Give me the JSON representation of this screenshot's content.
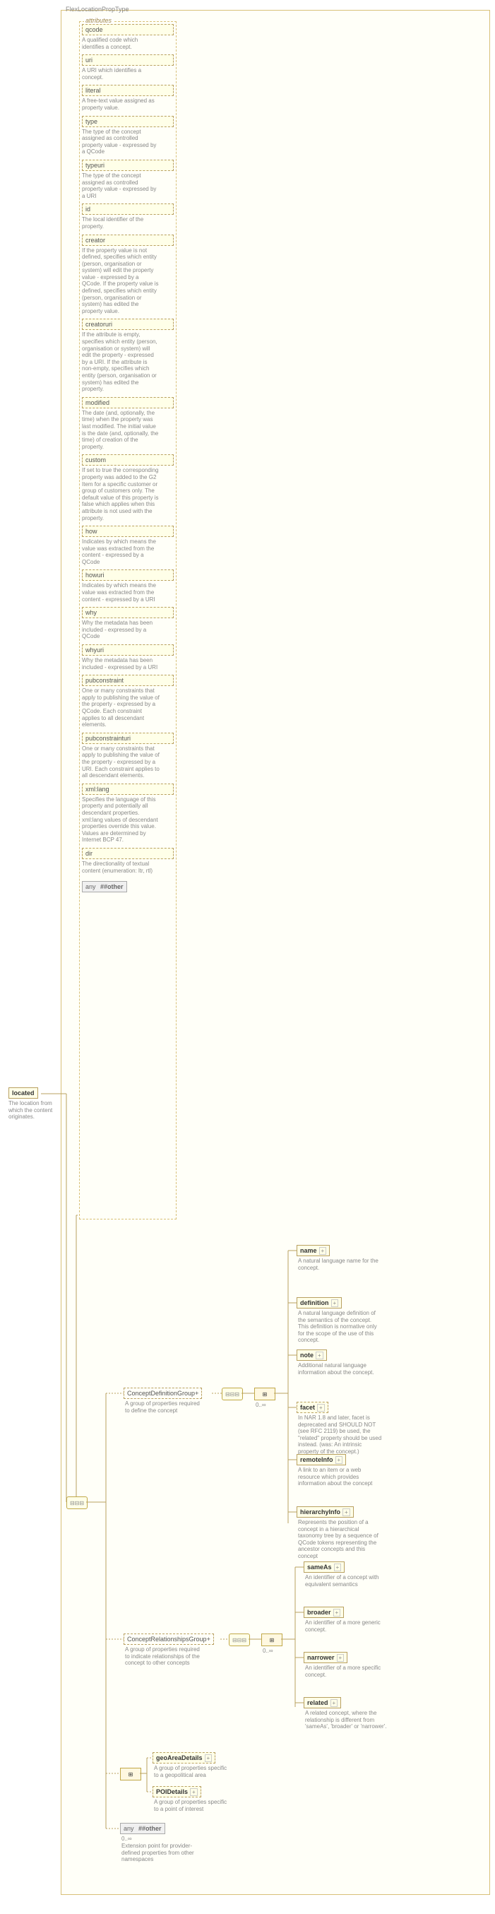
{
  "root": {
    "type_name": "FlexLocationPropType",
    "located": {
      "name": "located",
      "desc": "The location from which the content originates."
    },
    "attributes_label": "attributes",
    "attrs": [
      {
        "name": "qcode",
        "desc": "A qualified code which identifies a concept."
      },
      {
        "name": "uri",
        "desc": "A URI which identifies a concept."
      },
      {
        "name": "literal",
        "desc": "A free-text value assigned as property value."
      },
      {
        "name": "type",
        "desc": "The type of the concept assigned as controlled property value - expressed by a QCode"
      },
      {
        "name": "typeuri",
        "desc": "The type of the concept assigned as controlled property value - expressed by a URI"
      },
      {
        "name": "id",
        "desc": "The local identifier of the property."
      },
      {
        "name": "creator",
        "desc": "If the property value is not defined, specifies which entity (person, organisation or system) will edit the property value - expressed by a QCode. If the property value is defined, specifies which entity (person, organisation or system) has edited the property value."
      },
      {
        "name": "creatoruri",
        "desc": "If the attribute is empty, specifies which entity (person, organisation or system) will edit the property - expressed by a URI. If the attribute is non-empty, specifies which entity (person, organisation or system) has edited the property."
      },
      {
        "name": "modified",
        "desc": "The date (and, optionally, the time) when the property was last modified. The initial value is the date (and, optionally, the time) of creation of the property."
      },
      {
        "name": "custom",
        "desc": "If set to true the corresponding property was added to the G2 Item for a specific customer or group of customers only. The default value of this property is false which applies when this attribute is not used with the property."
      },
      {
        "name": "how",
        "desc": "Indicates by which means the value was extracted from the content - expressed by a QCode"
      },
      {
        "name": "howuri",
        "desc": "Indicates by which means the value was extracted from the content - expressed by a URI"
      },
      {
        "name": "why",
        "desc": "Why the metadata has been included - expressed by a QCode"
      },
      {
        "name": "whyuri",
        "desc": "Why the metadata has been included - expressed by a URI"
      },
      {
        "name": "pubconstraint",
        "desc": "One or many constraints that apply to publishing the value of the property - expressed by a QCode. Each constraint applies to all descendant elements."
      },
      {
        "name": "pubconstrainturi",
        "desc": "One or many constraints that apply to publishing the value of the property - expressed by a URI. Each constraint applies to all descendant elements."
      },
      {
        "name": "xml:lang",
        "desc": "Specifies the language of this property and potentially all descendant properties. xml:lang values of descendant properties override this value. Values are determined by Internet BCP 47."
      },
      {
        "name": "dir",
        "desc": "The directionality of textual content (enumeration: ltr, rtl)"
      }
    ],
    "any_attr": "##other",
    "groups": {
      "cdg": {
        "name": "ConceptDefinitionGroup",
        "desc": "A group of properties required to define the concept",
        "card": "0..∞"
      },
      "crg": {
        "name": "ConceptRelationshipsGroup",
        "desc": "A group of properties required to indicate relationships of the concept to other concepts",
        "card": "0..∞"
      },
      "gad": {
        "name": "geoAreaDetails",
        "desc": "A group of properties specific to a geopolitical area"
      },
      "poi": {
        "name": "POIDetails",
        "desc": "A group of properties specific to a point of interest"
      }
    },
    "cdg_children": [
      {
        "name": "name",
        "desc": "A natural language name for the concept."
      },
      {
        "name": "definition",
        "desc": "A natural language definition of the semantics of the concept. This definition is normative only for the scope of the use of this concept."
      },
      {
        "name": "note",
        "desc": "Additional natural language information about the concept."
      },
      {
        "name": "facet",
        "desc": "In NAR 1.8 and later, facet is deprecated and SHOULD NOT (see RFC 2119) be used, the \"related\" property should be used instead. (was: An intrinsic property of the concept.)"
      },
      {
        "name": "remoteInfo",
        "desc": "A link to an item or a web resource which provides information about the concept"
      },
      {
        "name": "hierarchyInfo",
        "desc": "Represents the position of a concept in a hierarchical taxonomy tree by a sequence of QCode tokens representing the ancestor concepts and this concept"
      }
    ],
    "crg_children": [
      {
        "name": "sameAs",
        "desc": "An identifier of a concept with equivalent semantics"
      },
      {
        "name": "broader",
        "desc": "An identifier of a more generic concept."
      },
      {
        "name": "narrower",
        "desc": "An identifier of a more specific concept."
      },
      {
        "name": "related",
        "desc": "A related concept, where the relationship is different from 'sameAs', 'broader' or 'narrower'."
      }
    ],
    "any_el": {
      "name": "##other",
      "desc": "Extension point for provider-defined properties from other namespaces",
      "card": "0..∞"
    },
    "any_label": "any"
  }
}
